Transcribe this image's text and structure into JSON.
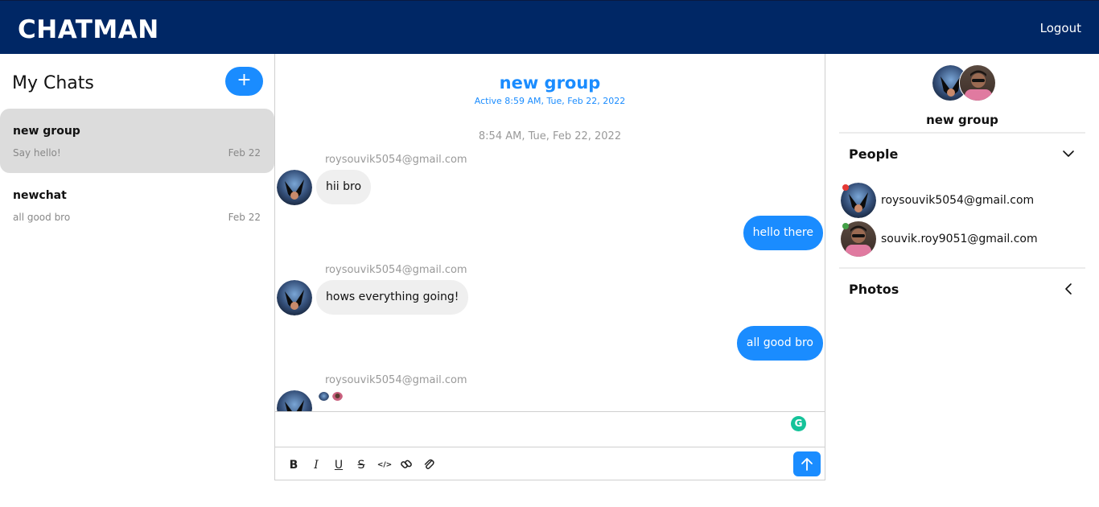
{
  "header": {
    "brand": "CHATMAN",
    "logout_label": "Logout"
  },
  "sidebar": {
    "title": "My Chats",
    "add_icon_glyph": "+",
    "chats": [
      {
        "name": "new group",
        "last_message": "Say hello!",
        "date": "Feb 22",
        "active": true
      },
      {
        "name": "newchat",
        "last_message": "all good bro",
        "date": "Feb 22",
        "active": false
      }
    ]
  },
  "conversation": {
    "title": "new group",
    "subtitle": "Active 8:59 AM, Tue, Feb 22, 2022",
    "time_divider": "8:54 AM, Tue, Feb 22, 2022",
    "messages": [
      {
        "sender": "roysouvik5054@gmail.com",
        "text": "hii bro",
        "outgoing": false
      },
      {
        "text": "hello there",
        "outgoing": true
      },
      {
        "sender": "roysouvik5054@gmail.com",
        "text": "hows everything going!",
        "outgoing": false
      },
      {
        "text": "all good bro",
        "outgoing": true
      },
      {
        "sender": "roysouvik5054@gmail.com",
        "text": "",
        "outgoing": false
      }
    ],
    "composer": {
      "value": "",
      "format_buttons": [
        "B",
        "I",
        "U",
        "S",
        "</>",
        "link",
        "attach"
      ]
    }
  },
  "details": {
    "group_name": "new group",
    "people_label": "People",
    "photos_label": "Photos",
    "people": [
      {
        "email": "roysouvik5054@gmail.com",
        "status_color": "#e53935"
      },
      {
        "email": "souvik.roy9051@gmail.com",
        "status_color": "#43a047"
      }
    ]
  },
  "colors": {
    "header": "#002765",
    "accent": "#1a8cff",
    "active_chat": "#dcdcdc",
    "incoming_bubble": "#efefef"
  }
}
